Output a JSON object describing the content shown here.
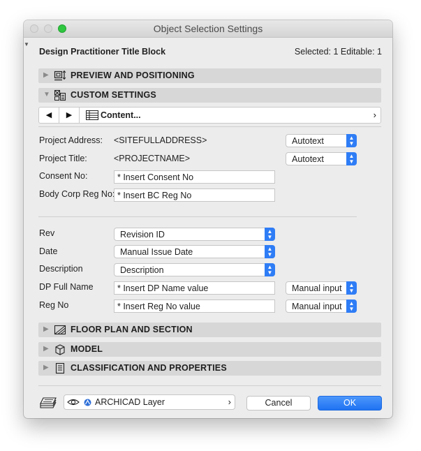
{
  "window": {
    "title": "Object Selection Settings"
  },
  "header": {
    "object_name": "Design Practitioner Title Block",
    "selection_info": "Selected: 1 Editable: 1"
  },
  "sections": {
    "preview": {
      "title": "PREVIEW AND POSITIONING",
      "icon": "preview-positioning-icon",
      "expanded": false
    },
    "custom": {
      "title": "CUSTOM SETTINGS",
      "icon": "custom-settings-icon",
      "expanded": true
    },
    "floor": {
      "title": "FLOOR PLAN AND SECTION",
      "icon": "floor-plan-icon",
      "expanded": false
    },
    "model": {
      "title": "MODEL",
      "icon": "model-cube-icon",
      "expanded": false
    },
    "classification": {
      "title": "CLASSIFICATION AND PROPERTIES",
      "icon": "classification-icon",
      "expanded": false
    }
  },
  "nav": {
    "back": "◀",
    "forward": "▶",
    "content_label": "Content...",
    "chevron": "›"
  },
  "fields": {
    "project_address": {
      "label": "Project Address:",
      "value": "<SITEFULLADDRESS>",
      "mode": "Autotext"
    },
    "project_title": {
      "label": "Project Title:",
      "value": "<PROJECTNAME>",
      "mode": "Autotext"
    },
    "consent_no": {
      "label": "Consent No:",
      "value": "* Insert Consent No"
    },
    "body_corp": {
      "label": "Body Corp Reg No:",
      "value": "* Insert BC Reg No"
    },
    "rev": {
      "label": "Rev",
      "value": "Revision ID"
    },
    "date": {
      "label": "Date",
      "value": "Manual Issue Date"
    },
    "description": {
      "label": "Description",
      "value": "Description"
    },
    "dp_full_name": {
      "label": "DP Full Name",
      "value": "* Insert DP Name value",
      "mode": "Manual input"
    },
    "reg_no": {
      "label": "Reg No",
      "value": "* Insert Reg No value",
      "mode": "Manual input"
    }
  },
  "footer": {
    "layer_name": "ARCHICAD Layer",
    "layer_chevron": "›",
    "cancel_label": "Cancel",
    "ok_label": "OK"
  },
  "colors": {
    "accent": "#2f7df6",
    "section_bg": "#d7d7d7",
    "window_bg": "#ececec"
  }
}
